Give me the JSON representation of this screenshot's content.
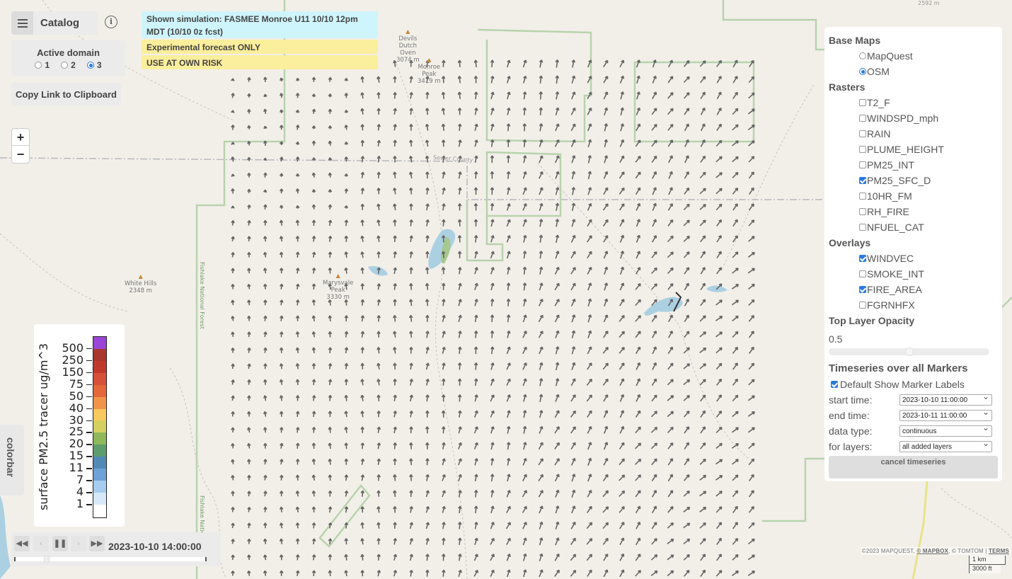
{
  "header": {
    "catalog_label": "Catalog",
    "info_icon": "info-icon",
    "menu_icon": "hamburger-icon"
  },
  "domain": {
    "title": "Active domain",
    "options": [
      "1",
      "2",
      "3"
    ],
    "selected": "3"
  },
  "copy_link_label": "Copy Link to Clipboard",
  "zoom": {
    "in": "+",
    "out": "−"
  },
  "banners": {
    "simulation": "Shown simulation: FASMEE Monroe U11 10/10 12pm MDT (10/10 0z fcst)",
    "experimental": "Experimental forecast ONLY",
    "risk": "USE AT OWN RISK"
  },
  "layers_panel": {
    "base_maps_title": "Base Maps",
    "base_maps": [
      {
        "label": "MapQuest",
        "selected": false
      },
      {
        "label": "OSM",
        "selected": true
      }
    ],
    "rasters_title": "Rasters",
    "rasters": [
      {
        "label": "T2_F",
        "checked": false
      },
      {
        "label": "WINDSPD_mph",
        "checked": false
      },
      {
        "label": "RAIN",
        "checked": false
      },
      {
        "label": "PLUME_HEIGHT",
        "checked": false
      },
      {
        "label": "PM25_INT",
        "checked": false
      },
      {
        "label": "PM25_SFC_D",
        "checked": true
      },
      {
        "label": "10HR_FM",
        "checked": false
      },
      {
        "label": "RH_FIRE",
        "checked": false
      },
      {
        "label": "NFUEL_CAT",
        "checked": false
      }
    ],
    "overlays_title": "Overlays",
    "overlays": [
      {
        "label": "WINDVEC",
        "checked": true
      },
      {
        "label": "SMOKE_INT",
        "checked": false
      },
      {
        "label": "FIRE_AREA",
        "checked": true
      },
      {
        "label": "FGRNHFX",
        "checked": false
      }
    ],
    "opacity_title": "Top Layer Opacity",
    "opacity_value": "0.5",
    "opacity_fraction": 0.5,
    "timeseries_title": "Timeseries over all Markers",
    "show_marker_labels_label": "Default Show Marker Labels",
    "show_marker_labels_checked": true,
    "start_time_label": "start time:",
    "start_time_value": "2023-10-10 11:00:00",
    "end_time_label": "end time:",
    "end_time_value": "2023-10-11 11:00:00",
    "data_type_label": "data type:",
    "data_type_value": "continuous",
    "for_layers_label": "for layers:",
    "for_layers_value": "all added layers",
    "cancel_label": "cancel timeseries"
  },
  "colorbar": {
    "tab_label": "colorbar",
    "title": "surface PM2.5 tracer ug/m^3",
    "ticks": [
      "500",
      "250",
      "150",
      "75",
      "50",
      "40",
      "30",
      "25",
      "20",
      "15",
      "11",
      "7",
      "4",
      "1"
    ],
    "colors": [
      "#9b45d6",
      "#a8382e",
      "#c0392d",
      "#d6503a",
      "#e4683a",
      "#f0944c",
      "#f7c95e",
      "#d5d061",
      "#8fb85a",
      "#5e9c6d",
      "#5389b5",
      "#6da1d8",
      "#a6ccef",
      "#d6e9f9",
      "#ffffff"
    ]
  },
  "player": {
    "current_time": "2023-10-10 14:00:00",
    "progress_fraction": 0.15,
    "buttons": [
      "rewind",
      "step-back",
      "pause",
      "step-forward",
      "fast-forward"
    ]
  },
  "map": {
    "attribution": {
      "prefix": "©2023 MAPQUEST, ",
      "mapbox": "© MAPBOX",
      "mid": ", © TOMTOM | ",
      "terms": "TERMS"
    },
    "scale_km": "1 km",
    "scale_ft": "3000 ft",
    "labels": {
      "devils_dutch_oven": [
        "Devils",
        "Dutch",
        "Oven",
        "3074 m"
      ],
      "monroe_peak": [
        "Monroe",
        "Peak",
        "3419 m"
      ],
      "marysvale_peak": [
        "Marysvale",
        "Peak",
        "3330 m"
      ],
      "white_hills": [
        "White Hills",
        "2348 m"
      ],
      "top_elev": "2592 m",
      "sevier_county": "Sevier County",
      "fishlake_nf": "Fishlake National Forest",
      "fishlake_nf2": "Fishlake Natio"
    }
  }
}
